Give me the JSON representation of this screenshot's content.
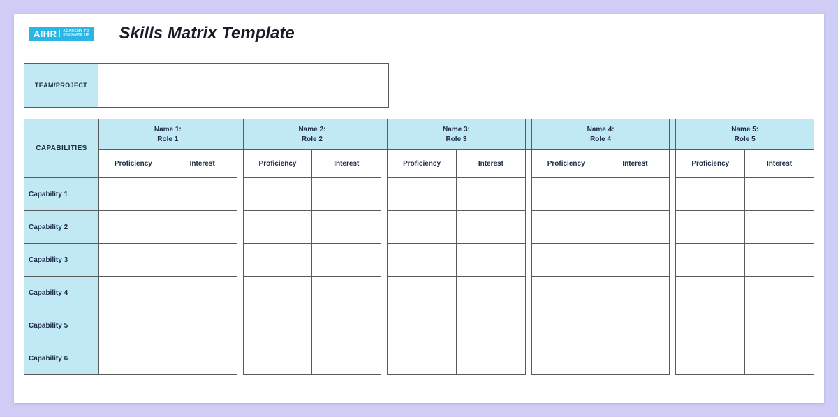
{
  "logo": {
    "text": "AIHR",
    "sub1": "ACADEMY TO",
    "sub2": "INNOVATE HR"
  },
  "title": "Skills Matrix Template",
  "team_label": "TEAM/PROJECT",
  "team_value": "",
  "capabilities_heading": "CAPABILITIES",
  "sub": {
    "proficiency": "Proficiency",
    "interest": "Interest"
  },
  "members": [
    {
      "name": "Name 1:",
      "role": "Role 1"
    },
    {
      "name": "Name 2:",
      "role": "Role 2"
    },
    {
      "name": "Name 3:",
      "role": "Role 3"
    },
    {
      "name": "Name 4:",
      "role": "Role 4"
    },
    {
      "name": "Name 5:",
      "role": "Role 5"
    }
  ],
  "capabilities": [
    "Capability 1",
    "Capability 2",
    "Capability 3",
    "Capability 4",
    "Capability 5",
    "Capability 6"
  ]
}
